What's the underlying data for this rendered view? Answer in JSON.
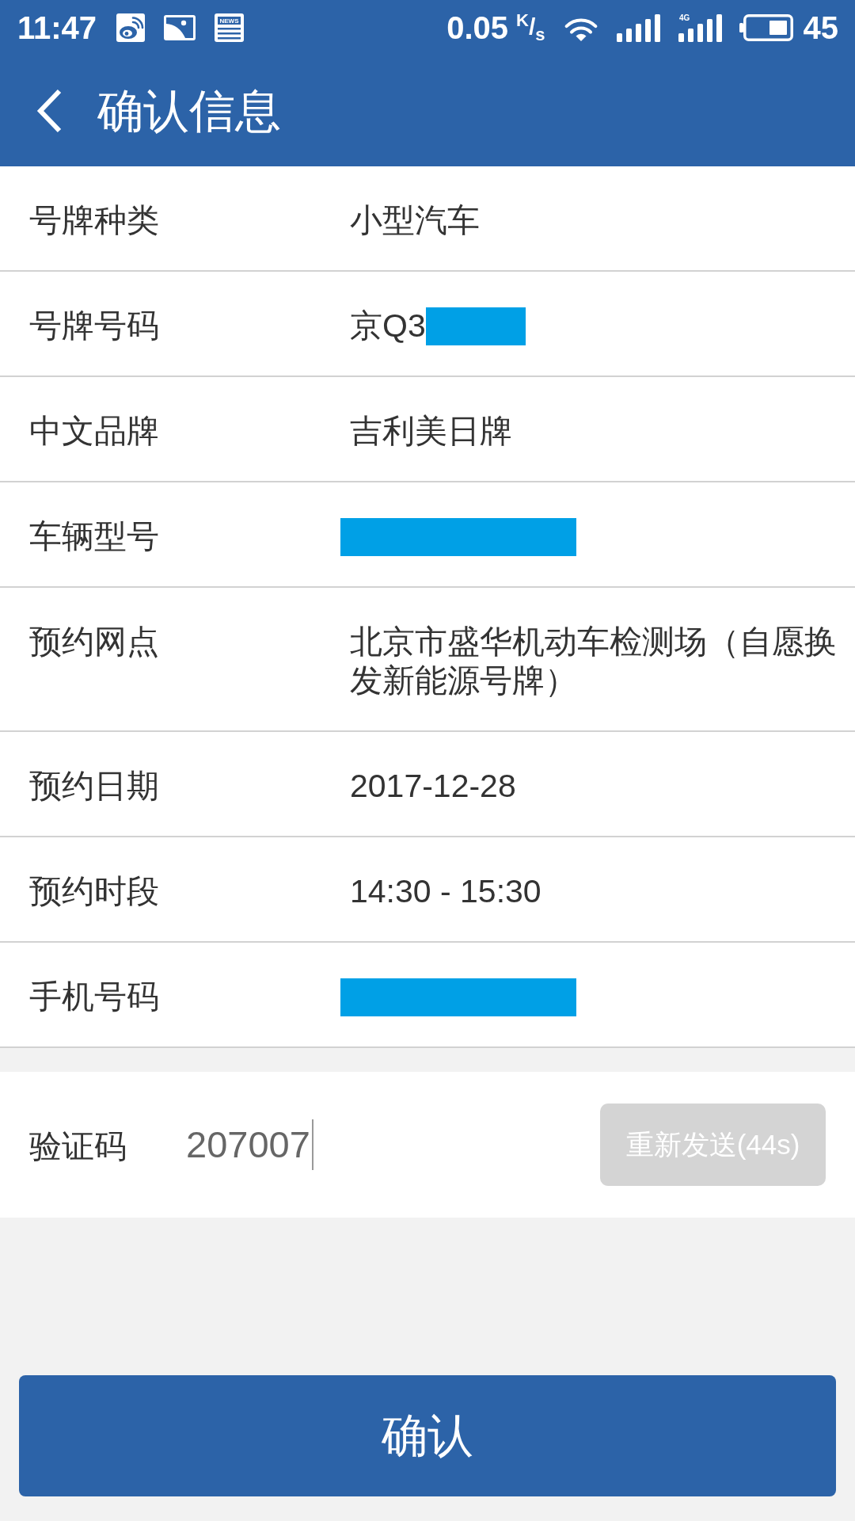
{
  "status_bar": {
    "time": "11:47",
    "notification_icons": [
      {
        "kind": "logo"
      },
      {
        "kind": "picture"
      },
      {
        "kind": "news",
        "label": "NEWS"
      }
    ],
    "net_speed": "0.05",
    "net_speed_unit": "$^{K}$/$_{s}$",
    "indicators": [
      {
        "kind": "wifi"
      },
      {
        "kind": "signal"
      },
      {
        "kind": "signal",
        "label": "4G"
      }
    ],
    "battery_percent": "45"
  },
  "header": {
    "title": "确认信息"
  },
  "rows": [
    {
      "label": "号牌种类",
      "value": "小型汽车",
      "redacted": false
    },
    {
      "label": "号牌号码",
      "value": "京Q3",
      "redacted": true
    },
    {
      "label": "中文品牌",
      "value": "吉利美日牌",
      "redacted": false
    },
    {
      "label": "车辆型号",
      "redacted": true
    },
    {
      "label": "预约网点",
      "value": "北京市盛华机动车检测场（自愿换发新能源号牌）",
      "redacted": false
    },
    {
      "label": "预约日期",
      "value": "2017-12-28",
      "redacted": false
    },
    {
      "label": "预约时段",
      "value": "14:30 - 15:30",
      "redacted": false
    },
    {
      "label": "手机号码",
      "redacted": true
    }
  ],
  "verification": {
    "label": "验证码",
    "value": "207007",
    "resend_button": {
      "label": "重新发送(44s)",
      "disabled": true
    }
  },
  "confirm_button": {
    "label": "确认"
  }
}
